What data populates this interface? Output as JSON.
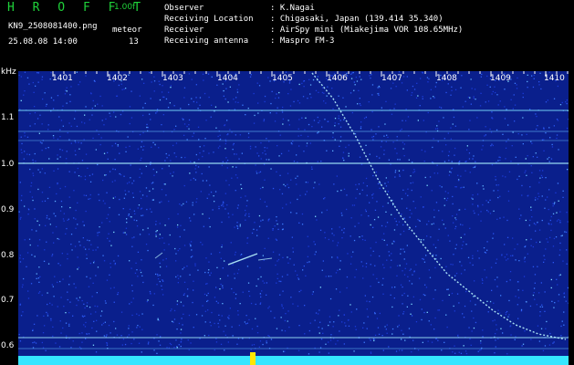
{
  "header": {
    "app_title": "H R O F F T",
    "version": "1.00f",
    "filename": "KN9_2508081400.png",
    "timestamp": "25.08.08 14:00",
    "count_label": "meteor",
    "count_value": "13",
    "info": [
      {
        "label": "Observer",
        "value": ": K.Nagai"
      },
      {
        "label": "Receiving Location",
        "value": ": Chigasaki, Japan (139.414 35.340)"
      },
      {
        "label": "Receiver",
        "value": ": AirSpy mini (Miakejima VOR 108.65MHz)"
      },
      {
        "label": "Receiving antenna",
        "value": ": Maspro FM-3"
      }
    ]
  },
  "axis": {
    "y_unit": "kHz",
    "y_ticks": [
      "1.1",
      "1.0",
      "0.9",
      "0.8",
      "0.7",
      "0.6"
    ],
    "x_ticks": [
      "1401",
      "1402",
      "1403",
      "1404",
      "1405",
      "1406",
      "1407",
      "1408",
      "1409",
      "1410"
    ]
  },
  "colors": {
    "background": "#0a1f8c",
    "noise_low": "#1b3bd8",
    "noise_high": "#7fdcff",
    "trace": "#b8f4ff",
    "baseline": "#35e6ff"
  }
}
